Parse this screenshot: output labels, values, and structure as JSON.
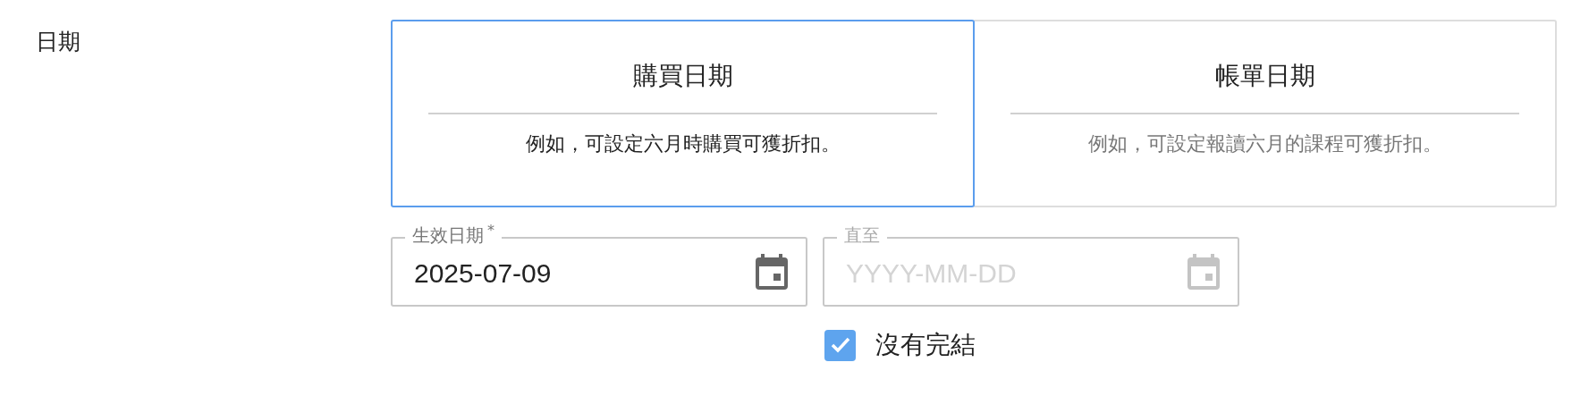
{
  "section_label": "日期",
  "date_types": [
    {
      "title": "購買日期",
      "description": "例如，可設定六月時購買可獲折扣。",
      "selected": true
    },
    {
      "title": "帳單日期",
      "description": "例如，可設定報讀六月的課程可獲折扣。",
      "selected": false
    }
  ],
  "fields": [
    {
      "label": "生效日期",
      "required_mark": "*",
      "value": "2025-07-09",
      "disabled": false
    },
    {
      "label": "直至",
      "placeholder": "YYYY-MM-DD",
      "disabled": true
    }
  ],
  "no_end": {
    "label": "沒有完結",
    "checked": true
  }
}
